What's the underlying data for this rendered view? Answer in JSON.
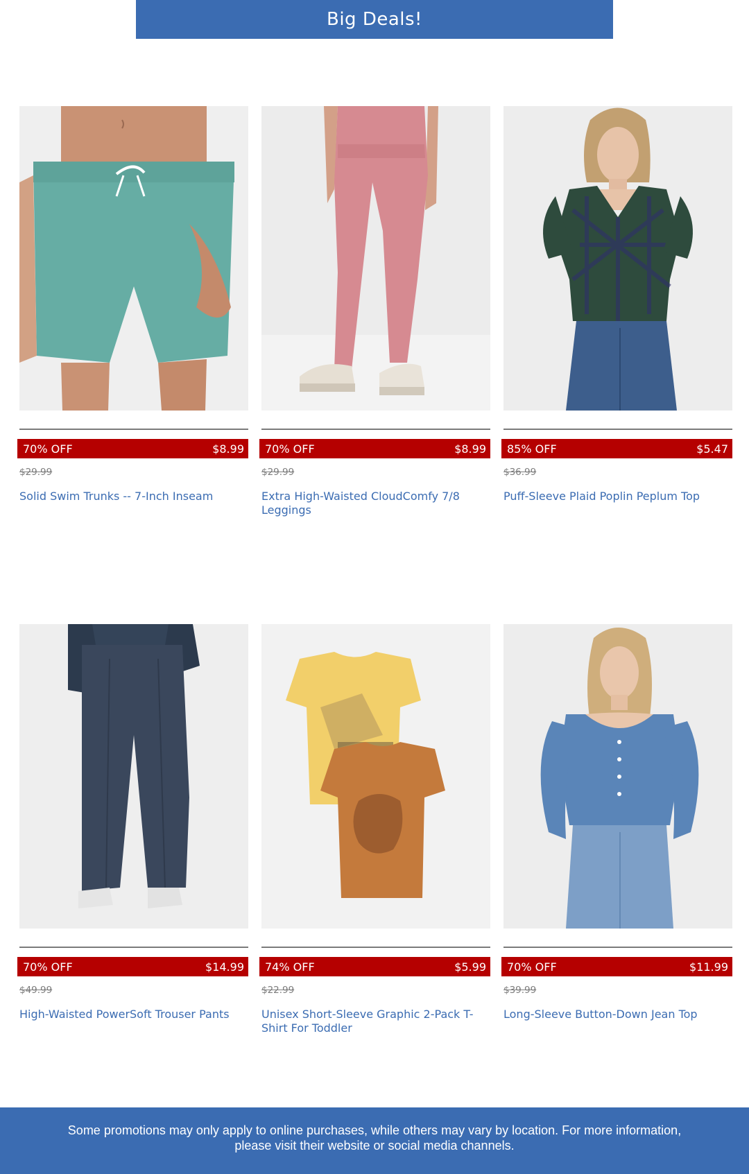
{
  "banner": {
    "title": "Big Deals!"
  },
  "products": [
    {
      "discount": "70% OFF",
      "price": "$8.99",
      "was_price": "$29.99",
      "title": "Solid Swim Trunks -- 7-Inch Inseam"
    },
    {
      "discount": "70% OFF",
      "price": "$8.99",
      "was_price": "$29.99",
      "title": "Extra High-Waisted CloudComfy 7/8 Leggings"
    },
    {
      "discount": "85% OFF",
      "price": "$5.47",
      "was_price": "$36.99",
      "title": "Puff-Sleeve Plaid Poplin Peplum Top"
    },
    {
      "discount": "70% OFF",
      "price": "$14.99",
      "was_price": "$49.99",
      "title": "High-Waisted PowerSoft Trouser Pants"
    },
    {
      "discount": "74% OFF",
      "price": "$5.99",
      "was_price": "$22.99",
      "title": "Unisex Short-Sleeve Graphic 2-Pack T-Shirt For Toddler"
    },
    {
      "discount": "70% OFF",
      "price": "$11.99",
      "was_price": "$39.99",
      "title": "Long-Sleeve Button-Down Jean Top"
    }
  ],
  "footer": {
    "text": "Some promotions may only apply to online purchases, while others may vary by location. For more information, please visit their website or social media channels."
  },
  "colors": {
    "brand_blue": "#3b6cb2",
    "deal_red": "#b50000"
  }
}
